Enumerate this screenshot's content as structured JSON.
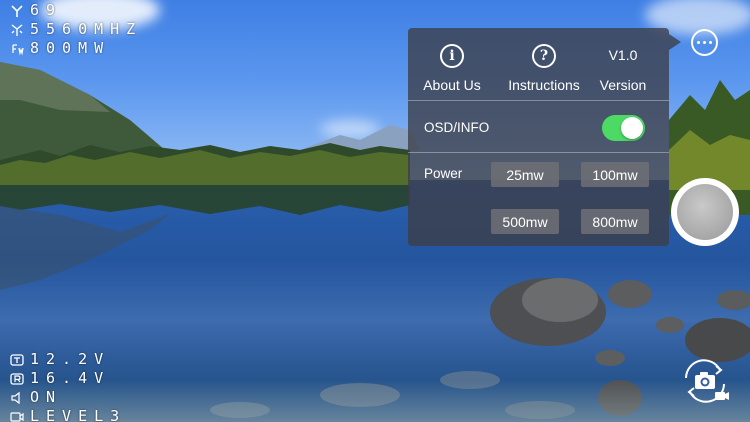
{
  "osd": {
    "top_left": {
      "signal": "69",
      "frequency": "5560MHZ",
      "power": "800MW"
    },
    "bottom_left": {
      "tx_voltage": "12.2V",
      "rx_voltage": "16.4V",
      "audio": "ON",
      "video_level": "LEVEL3"
    }
  },
  "menu": {
    "about_label": "About Us",
    "about_icon": "info-icon",
    "instructions_label": "Instructions",
    "instructions_icon": "help-icon",
    "version_value": "V1.0",
    "version_label": "Version",
    "osd_label": "OSD/INFO",
    "osd_enabled": true,
    "power_label": "Power",
    "power_options": [
      "25mw",
      "100mw",
      "500mw",
      "800mw"
    ]
  },
  "colors": {
    "toggle_on": "#4cd964",
    "panel_bg": "rgba(60,62,70,0.78)"
  },
  "icons": {
    "more": "more-options-icon",
    "shutter": "shutter-button",
    "switch_camera": "switch-camera-icon"
  }
}
